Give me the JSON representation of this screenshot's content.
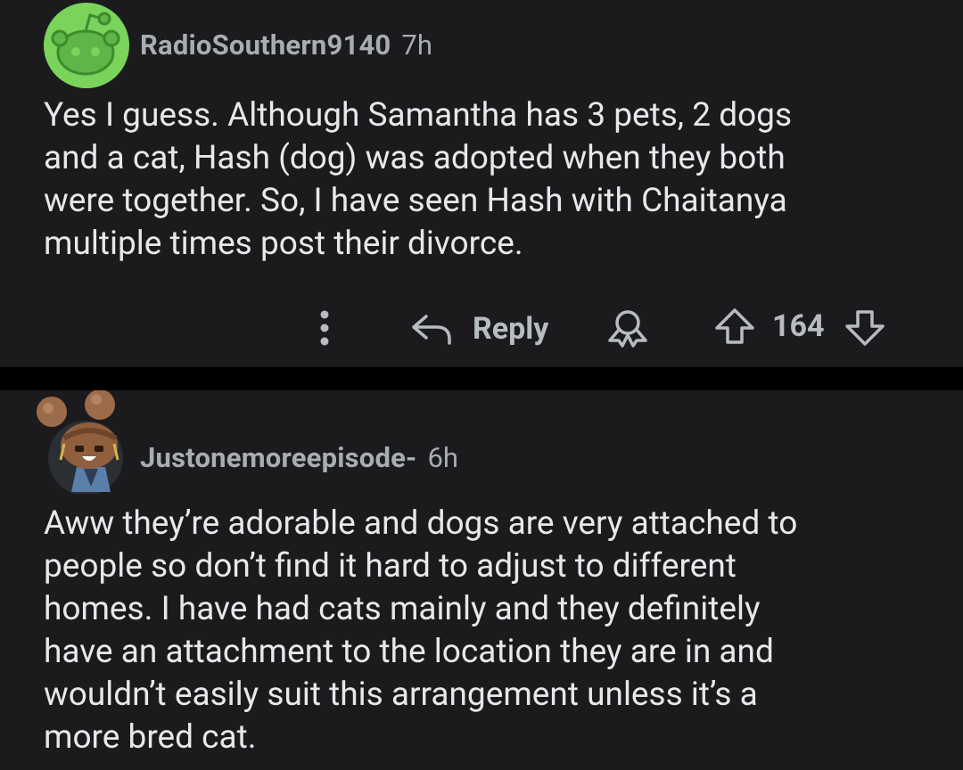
{
  "comments": [
    {
      "author": "RadioSouthern9140",
      "age": "7h",
      "body": "Yes I guess. Although Samantha has 3 pets, 2 dogs\nand a cat, Hash (dog) was adopted when they both\nwere together. So, I have seen Hash with Chaitanya\nmultiple times post their divorce.",
      "actions": {
        "more_icon": "more-vertical-icon",
        "reply_icon": "reply-arrow-icon",
        "reply_label": "Reply",
        "award_icon": "award-icon",
        "upvote_icon": "upvote-arrow-icon",
        "score": "164",
        "downvote_icon": "downvote-arrow-icon"
      },
      "avatar_color": "#7ad35b"
    },
    {
      "author": "Justonemoreepisode-",
      "age": "6h",
      "body": "Aww they’re adorable and dogs are very attached to\npeople so don’t find it hard to adjust to different\nhomes. I have had cats mainly and they definitely\nhave an attachment to the location they are in and\nwouldn’t easily suit this arrangement unless it’s a\nmore bred cat."
    }
  ],
  "colors": {
    "background": "#1b1b1d",
    "separator": "#000000",
    "meta_text": "#a8adb2",
    "body_text": "#e6e8ea"
  }
}
